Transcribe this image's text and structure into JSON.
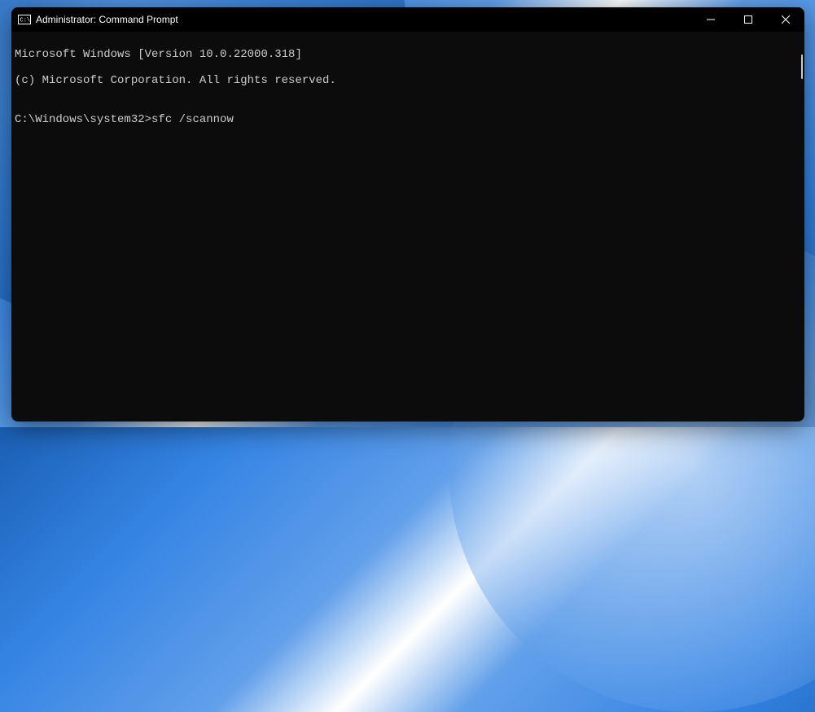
{
  "titlebar": {
    "title": "Administrator: Command Prompt"
  },
  "terminal": {
    "line1": "Microsoft Windows [Version 10.0.22000.318]",
    "line2": "(c) Microsoft Corporation. All rights reserved.",
    "blank": "",
    "prompt": "C:\\Windows\\system32>",
    "command": "sfc /scannow"
  }
}
